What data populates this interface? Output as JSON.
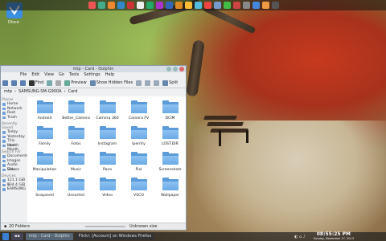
{
  "desktop": {
    "logo_label": "Disco"
  },
  "window": {
    "title": "mtp - Card - Dolphin",
    "menus": [
      "File",
      "Edit",
      "View",
      "Go",
      "Tools",
      "Settings",
      "Help"
    ],
    "toolbar": {
      "find": "Find",
      "preview": "Preview",
      "show_hidden": "Show Hidden Files",
      "split": "Split"
    },
    "location": [
      "mtp",
      "SAMSUNG-SM-G900A",
      "Card"
    ]
  },
  "sidebar": [
    {
      "section": "Places",
      "items": [
        "Home",
        "Network",
        "Root",
        "Trash"
      ]
    },
    {
      "section": "Recently Saved",
      "items": [
        "Today",
        "Yesterday",
        "This Month",
        "Last Month"
      ]
    },
    {
      "section": "Search For",
      "items": [
        "Documents",
        "Images",
        "Audio Files",
        "Videos"
      ]
    },
    {
      "section": "Devices",
      "items": [
        "121.1 GiB H",
        "134.4 GiB I",
        "SAMSUNG"
      ]
    }
  ],
  "folders": [
    "Android",
    "Better_Camera",
    "Camera 360",
    "Camera FV",
    "DCIM",
    "Family",
    "Fotos",
    "Instagram",
    "Iperrity",
    "LOST.DIR",
    "Manipulation",
    "Music",
    "Pano",
    "Pixl",
    "Screenshots",
    "Snapseed",
    "Unsorted",
    "Video",
    "VSCO",
    "Wallpaper"
  ],
  "statusbar": {
    "count": "20 Folders",
    "free": "Unknown size"
  },
  "taskbar": {
    "task1": "mtp - Card - Dolphin",
    "task2": "Flickr: [Account] on Windows Firefox",
    "time": "08:55:25 PM",
    "date": "Sunday, November 17, 2013"
  },
  "colors": {
    "folder": "#5b9bd9",
    "window_bg": "#eff0f1",
    "panel": "#1e1e1e",
    "tree_red": "#c73a1e"
  }
}
